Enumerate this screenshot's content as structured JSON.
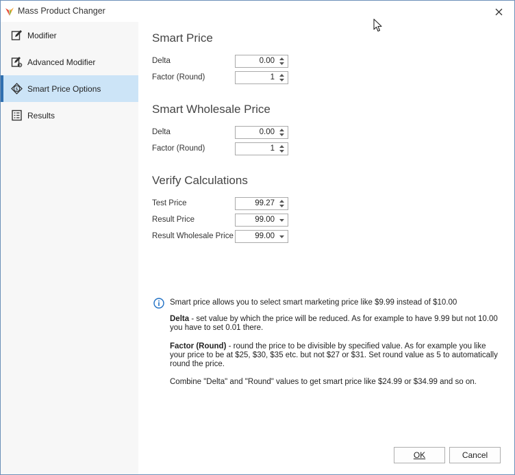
{
  "window": {
    "title": "Mass Product Changer"
  },
  "sidebar": {
    "items": [
      {
        "label": "Modifier",
        "icon": "edit-icon",
        "active": false
      },
      {
        "label": "Advanced Modifier",
        "icon": "advanced-edit-icon",
        "active": false
      },
      {
        "label": "Smart Price Options",
        "icon": "smart-price-icon",
        "active": true
      },
      {
        "label": "Results",
        "icon": "results-icon",
        "active": false
      }
    ]
  },
  "smart_price": {
    "title": "Smart Price",
    "delta_label": "Delta",
    "delta_value": "0.00",
    "factor_label": "Factor (Round)",
    "factor_value": "1"
  },
  "smart_wholesale": {
    "title": "Smart Wholesale Price",
    "delta_label": "Delta",
    "delta_value": "0.00",
    "factor_label": "Factor (Round)",
    "factor_value": "1"
  },
  "verify": {
    "title": "Verify Calculations",
    "test_label": "Test Price",
    "test_value": "99.27",
    "result_label": "Result Price",
    "result_value": "99.00",
    "wholesale_label": "Result Wholesale Price",
    "wholesale_value": "99.00"
  },
  "info": {
    "headline": "Smart price allows you to select smart marketing price like $9.99 instead of $10.00",
    "delta_term": "Delta",
    "delta_text": " - set value by which the price will be reduced. As for example to have 9.99 but not 10.00 you have to set 0.01 there.",
    "factor_term": "Factor (Round)",
    "factor_text": " - round the price to be divisible by specified value. As for example you like your price to be at $25, $30, $35 etc. but not $27 or $31. Set round value as 5 to automatically round the price.",
    "combine_text": "Combine \"Delta\" and \"Round\" values to get smart price like $24.99 or $34.99 and so on."
  },
  "buttons": {
    "ok": "OK",
    "cancel": "Cancel"
  },
  "colors": {
    "accent": "#2f6fb0",
    "active_bg": "#cce4f7",
    "info_icon": "#1e6fc4"
  }
}
